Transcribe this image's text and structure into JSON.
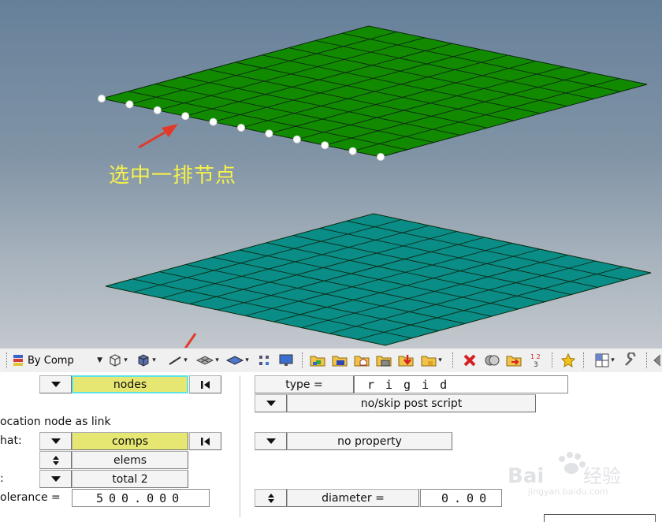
{
  "annotation": {
    "text": "选中一排节点"
  },
  "toolbar": {
    "color_mode_label": "By Comp",
    "icons": [
      "component-color-icon",
      "wireframe-cube-icon",
      "shaded-cube-icon",
      "line-style-icon",
      "mesh-plane-icon",
      "solid-plane-icon",
      "node-grid-icon",
      "monitor-icon",
      "folder-assembly-icon",
      "folder-blue-icon",
      "folder-house-icon",
      "folder-disk-icon",
      "folder-red-arrow-icon",
      "folder-yellow-icon",
      "delete-icon",
      "copy-icon",
      "paste-icon",
      "numbering-icon",
      "favorite-star-icon",
      "window-layout-icon",
      "wrench-icon"
    ]
  },
  "panel": {
    "left": {
      "entity_selector_1": "nodes",
      "location_label": "ocation node as link",
      "format_label": "hat:",
      "entity_selector_2": "comps",
      "elems_toggle": "elems",
      "colon_label": ":",
      "total_selector": "total 2",
      "tolerance_label": "olerance =",
      "tolerance_value": "500.000"
    },
    "right": {
      "type_label": "type =",
      "type_value": "rigid",
      "post_script": "no/skip post script",
      "property": "no property",
      "diameter_label": "diameter =",
      "diameter_value": "0.00"
    }
  },
  "watermark": {
    "brand": "Baidu经验",
    "url": "jingyan.baidu.com"
  },
  "colors": {
    "upper_mesh": "#118a00",
    "lower_mesh": "#0a8c87",
    "highlight_yellow": "#e6e672",
    "highlight_cyan": "#5ee3e6",
    "annotation": "#f6f24a",
    "arrow": "#e23a2a"
  }
}
